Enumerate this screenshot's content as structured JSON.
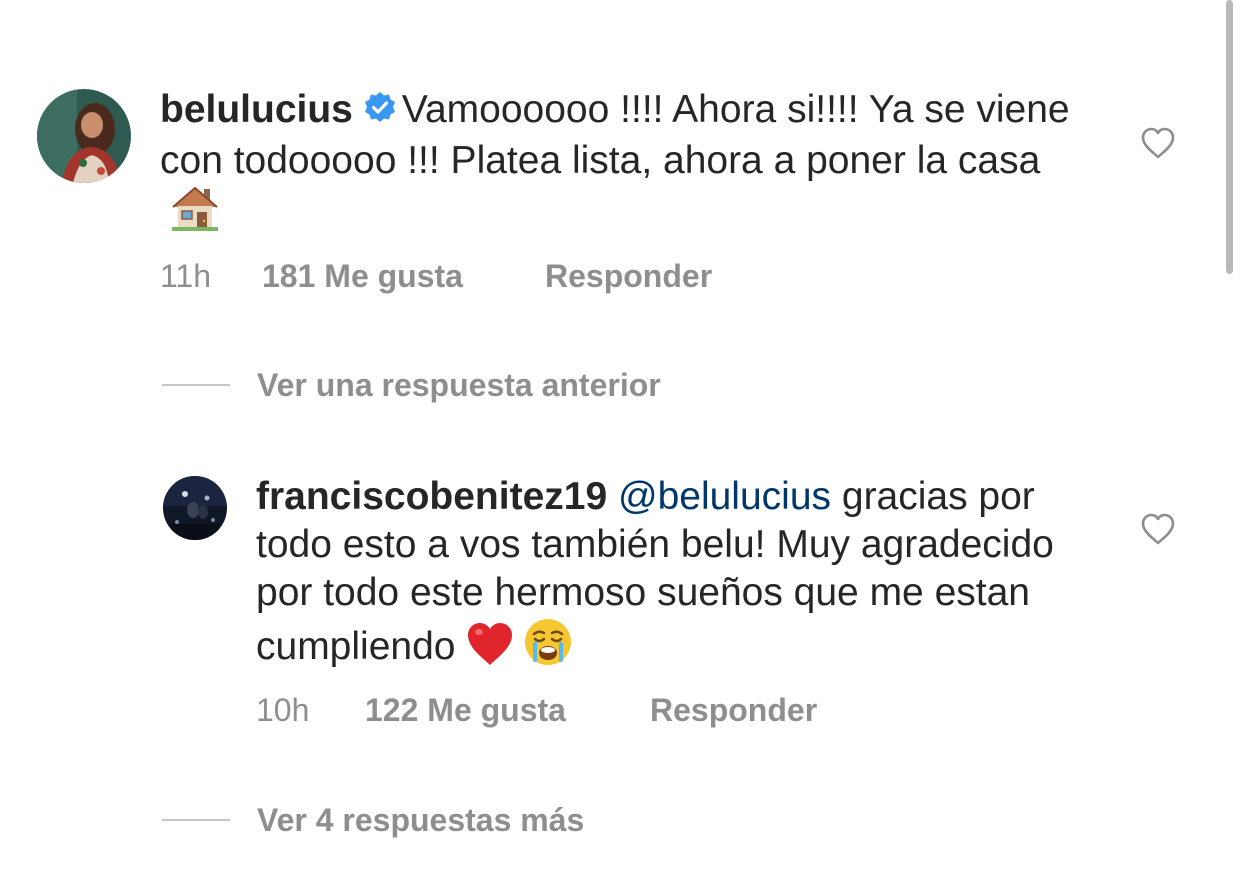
{
  "comments": [
    {
      "username": "belulucius",
      "verified": true,
      "text": "Vamoooooo !!!! Ahora si!!!! Ya se viene con todooooo !!! Platea lista, ahora a poner la casa",
      "emoji": "house-emoji",
      "time": "11h",
      "likes": "181 Me gusta",
      "reply": "Responder",
      "like_icon": "heart-outline-icon"
    },
    {
      "username": "franciscobenitez19",
      "mention": "@belulucius",
      "text": "gracias por todo esto a vos también  belu! Muy agradecido por todo este hermoso sueños que me estan cumpliendo",
      "emojis": [
        "red-heart-emoji",
        "crying-face-emoji"
      ],
      "time": "10h",
      "likes": "122 Me gusta",
      "reply": "Responder",
      "like_icon": "heart-outline-icon"
    }
  ],
  "view_previous_reply": "Ver una respuesta anterior",
  "view_more_replies": "Ver 4 respuestas más",
  "colors": {
    "text": "#262626",
    "secondary": "#8e8e8e",
    "mention": "#00376b",
    "verified": "#3897f0"
  }
}
